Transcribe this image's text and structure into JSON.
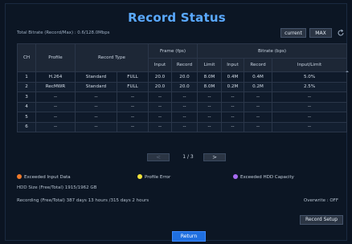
{
  "title": "Record Status",
  "bitrate_summary": "Total Bitrate (Record/Max) : 0.6/128.0Mbps",
  "buttons": {
    "current": "current",
    "max": "MAX",
    "record_setup": "Record Setup",
    "return": "Return"
  },
  "table": {
    "headers": {
      "ch": "CH",
      "profile": "Profile",
      "record_type": "Record Type",
      "frame_group": "Frame (fps)",
      "bitrate_group": "Bitrate (bps)",
      "frame_input": "Input",
      "frame_record": "Record",
      "bitrate_limit": "Limit",
      "bitrate_input": "Input",
      "bitrate_record": "Record",
      "bitrate_ratio": "Input/Limit"
    },
    "rows": [
      [
        "1",
        "H.264",
        "Standard",
        "FULL",
        "20.0",
        "20.0",
        "8.0M",
        "0.4M",
        "0.4M",
        "5.0%"
      ],
      [
        "2",
        "RecMWR",
        "Standard",
        "FULL",
        "20.0",
        "20.0",
        "8.0M",
        "0.2M",
        "0.2M",
        "2.5%"
      ],
      [
        "3",
        "--",
        "--",
        "--",
        "--",
        "--",
        "--",
        "--",
        "--",
        "--"
      ],
      [
        "4",
        "--",
        "--",
        "--",
        "--",
        "--",
        "--",
        "--",
        "--",
        "--"
      ],
      [
        "5",
        "--",
        "--",
        "--",
        "--",
        "--",
        "--",
        "--",
        "--",
        "--"
      ],
      [
        "6",
        "--",
        "--",
        "--",
        "--",
        "--",
        "--",
        "--",
        "--",
        "--"
      ]
    ]
  },
  "pager": {
    "prev": "<",
    "next": ">",
    "page": "1 / 3"
  },
  "legend": {
    "exceeded_input": "Exceeded Input Data",
    "profile_error": "Profile Error",
    "exceeded_hdd": "Exceeded HDD Capacity",
    "colors": {
      "exceeded_input": "#f07a2a",
      "profile_error": "#f2e33a",
      "exceeded_hdd": "#a76bf2"
    }
  },
  "hdd_size": "HDD Size (Free/Total) 1915/1962 GB",
  "recording": "Recording (Free/Total) 387 days 13 hours /315 days 2 hours",
  "overwrite": "Overwrite : OFF"
}
